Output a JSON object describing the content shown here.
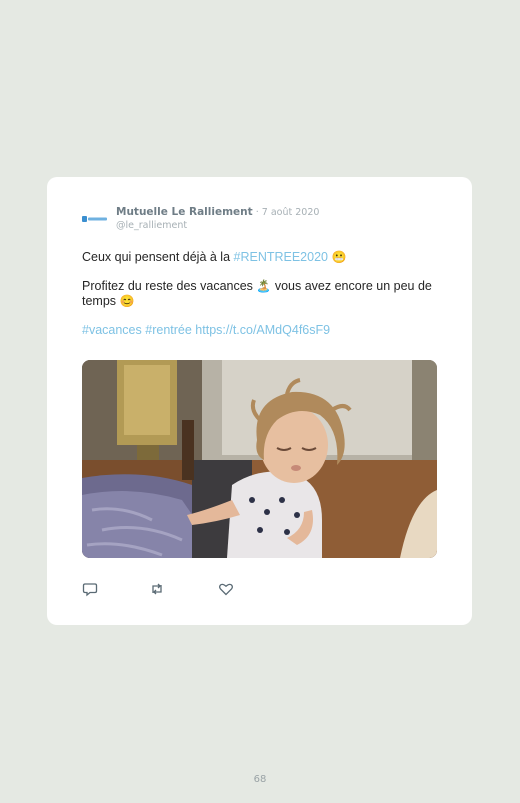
{
  "tweet": {
    "author_name": "Mutuelle Le Ralliement",
    "separator": "·",
    "date": "7 août 2020",
    "handle": "@le_ralliement",
    "avatar_icon": "le-ralliement-logo",
    "line1_text": "Ceux qui pensent déjà à la ",
    "line1_hashtag": "#RENTREE2020",
    "line1_emoji": "😬",
    "line2_text_a": "Profitez du reste des vacances ",
    "line2_emoji_a": "🏝️",
    "line2_text_b": " vous avez encore un peu de temps ",
    "line2_emoji_b": "😊",
    "hashtag_vacances": "#vacances",
    "hashtag_rentree": "#rentrée",
    "link": "https://t.co/AMdQ4f6sF9",
    "media_description_icon": "sleepy-toddler-photo",
    "actions": [
      {
        "icon": "reply-icon"
      },
      {
        "icon": "retweet-icon"
      },
      {
        "icon": "like-icon"
      }
    ]
  },
  "page_number": "68",
  "colors": {
    "background": "#e5e9e3",
    "card": "#ffffff",
    "link": "#7ec2e4",
    "muted": "#a7b0b5",
    "author": "#6f7d86"
  }
}
